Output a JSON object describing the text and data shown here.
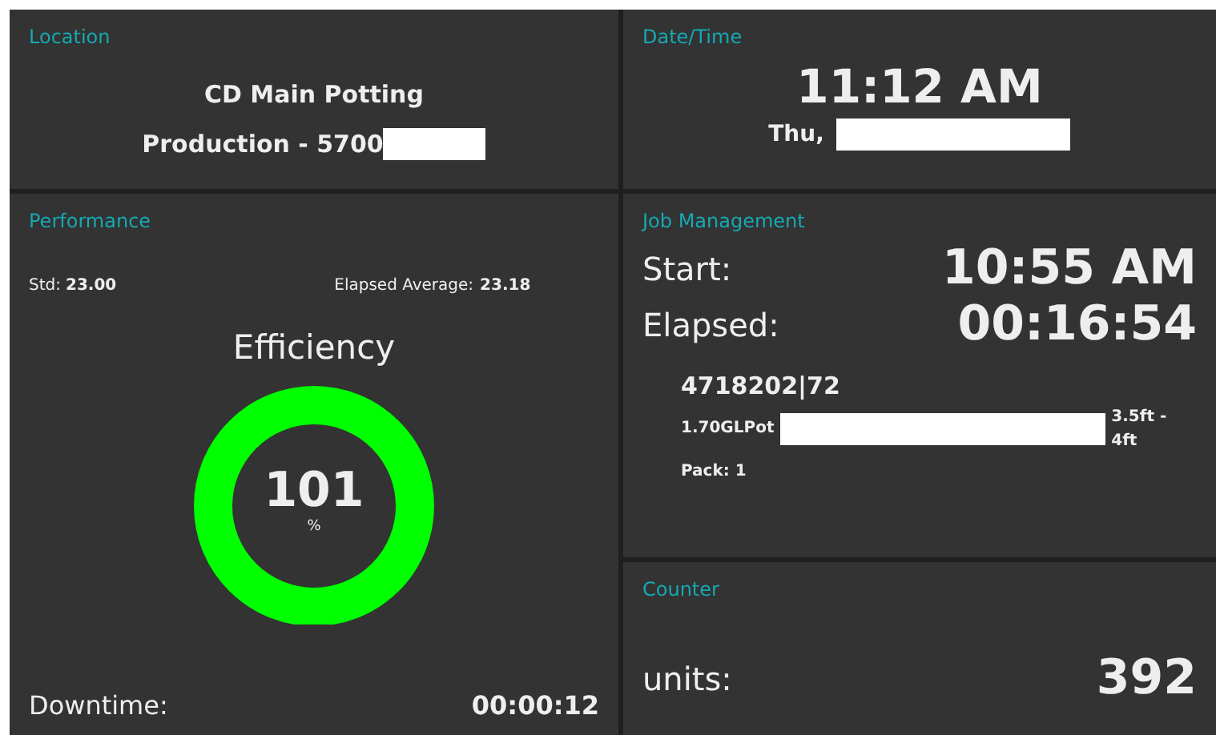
{
  "location": {
    "title": "Location",
    "name": "CD Main Potting",
    "line": "Production - 5700"
  },
  "datetime": {
    "title": "Date/Time",
    "time": "11:12 AM",
    "day": "Thu,"
  },
  "performance": {
    "title": "Performance",
    "std_label": "Std:",
    "std": "23.00",
    "avg_label": "Elapsed Average:",
    "avg": "23.18",
    "gauge_title": "Efficiency",
    "gauge_value": "101",
    "gauge_unit": "%",
    "downtime_label": "Downtime:",
    "downtime": "00:00:12"
  },
  "job": {
    "title": "Job Management",
    "start_label": "Start:",
    "start": "10:55 AM",
    "elapsed_label": "Elapsed:",
    "elapsed": "00:16:54",
    "order": "4718202|72",
    "item": "1.70GLPot",
    "size": "3.5ft - 4ft",
    "pack": "Pack: 1"
  },
  "counter": {
    "title": "Counter",
    "label": "units:",
    "value": "392"
  }
}
